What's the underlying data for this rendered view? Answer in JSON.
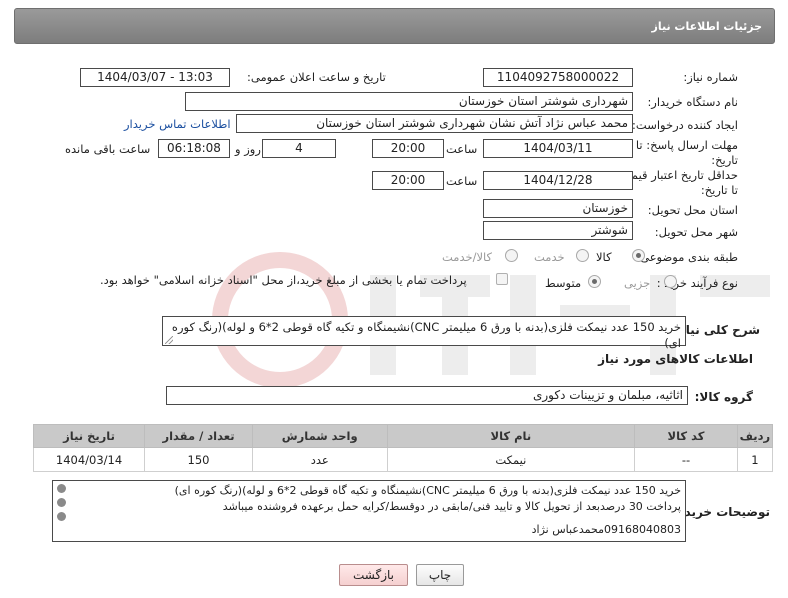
{
  "header": {
    "title": "جزئیات اطلاعات نیاز"
  },
  "fields": {
    "need_number_label": "شماره نیاز:",
    "need_number": "1104092758000022",
    "announce_label": "تاریخ و ساعت اعلان عمومی:",
    "announce_value": "1404/03/07 - 13:03",
    "buyer_org_label": "نام دستگاه خریدار:",
    "buyer_org": "شهرداری شوشتر استان خوزستان",
    "requester_label": "ایجاد کننده درخواست:",
    "requester": "محمد عباس نژاد آتش نشان شهرداری شوشتر استان خوزستان",
    "contact_link": "اطلاعات تماس خریدار",
    "reply_deadline_label": "مهلت ارسال پاسخ: تا تاریخ:",
    "reply_date": "1404/03/11",
    "time_label": "ساعت",
    "reply_time": "20:00",
    "days_value": "4",
    "day_and_label": "روز و",
    "remaining_time": "06:18:08",
    "remaining_label": "ساعت باقی مانده",
    "price_validity_label": "حداقل تاریخ اعتبار قیمت: تا تاریخ:",
    "price_date": "1404/12/28",
    "price_time": "20:00",
    "delivery_province_label": "استان محل تحویل:",
    "delivery_province": "خوزستان",
    "delivery_city_label": "شهر محل تحویل:",
    "delivery_city": "شوشتر",
    "category_label": "طبقه بندی موضوعی:",
    "category_options": [
      "کالا",
      "خدمت",
      "کالا/خدمت"
    ],
    "purchase_type_label": "نوع فرآیند خرید :",
    "purchase_type_options": [
      "جزیی",
      "متوسط"
    ],
    "payment_note": "پرداخت تمام یا بخشی از مبلغ خرید،از محل \"اسناد خزانه اسلامی\" خواهد بود."
  },
  "description": {
    "label": "شرح کلی نیاز:",
    "text": "خرید 150 عدد نیمکت فلزی(بدنه با ورق 6 میلیمتر CNC)نشیمنگاه و تکیه گاه قوطی 2*6 و لوله)(رنگ کوره ای)"
  },
  "goods": {
    "section_title": "اطلاعات کالاهای مورد نیاز",
    "group_label": "گروه کالا:",
    "group_value": "اثاثیه، مبلمان و تزیینات دکوری",
    "columns": [
      "ردیف",
      "کد کالا",
      "نام کالا",
      "واحد شمارش",
      "تعداد / مقدار",
      "تاریخ نیاز"
    ],
    "rows": [
      {
        "row": "1",
        "code": "--",
        "name": "نیمکت",
        "unit": "عدد",
        "qty": "150",
        "date": "1404/03/14"
      }
    ]
  },
  "buyer_notes": {
    "label": "توضیحات خریدار:",
    "line1": "خرید 150 عدد نیمکت فلزی(بدنه با ورق 6 میلیمتر CNC)نشیمنگاه و تکیه گاه قوطی 2*6 و لوله)(رنگ کوره ای)",
    "line2": "پرداخت 30 درصدبعد از تحویل کالا و تایید فنی/مابقی در دوقسط/کرایه حمل برعهده فروشنده میباشد",
    "line3": "09168040803محمدعباس نژاد"
  },
  "buttons": {
    "print": "چاپ",
    "back": "بازگشت"
  },
  "colors": {
    "header_bg": "#8a8a8a",
    "link": "#1b4fa0",
    "back_button": "#f5d0d0"
  }
}
